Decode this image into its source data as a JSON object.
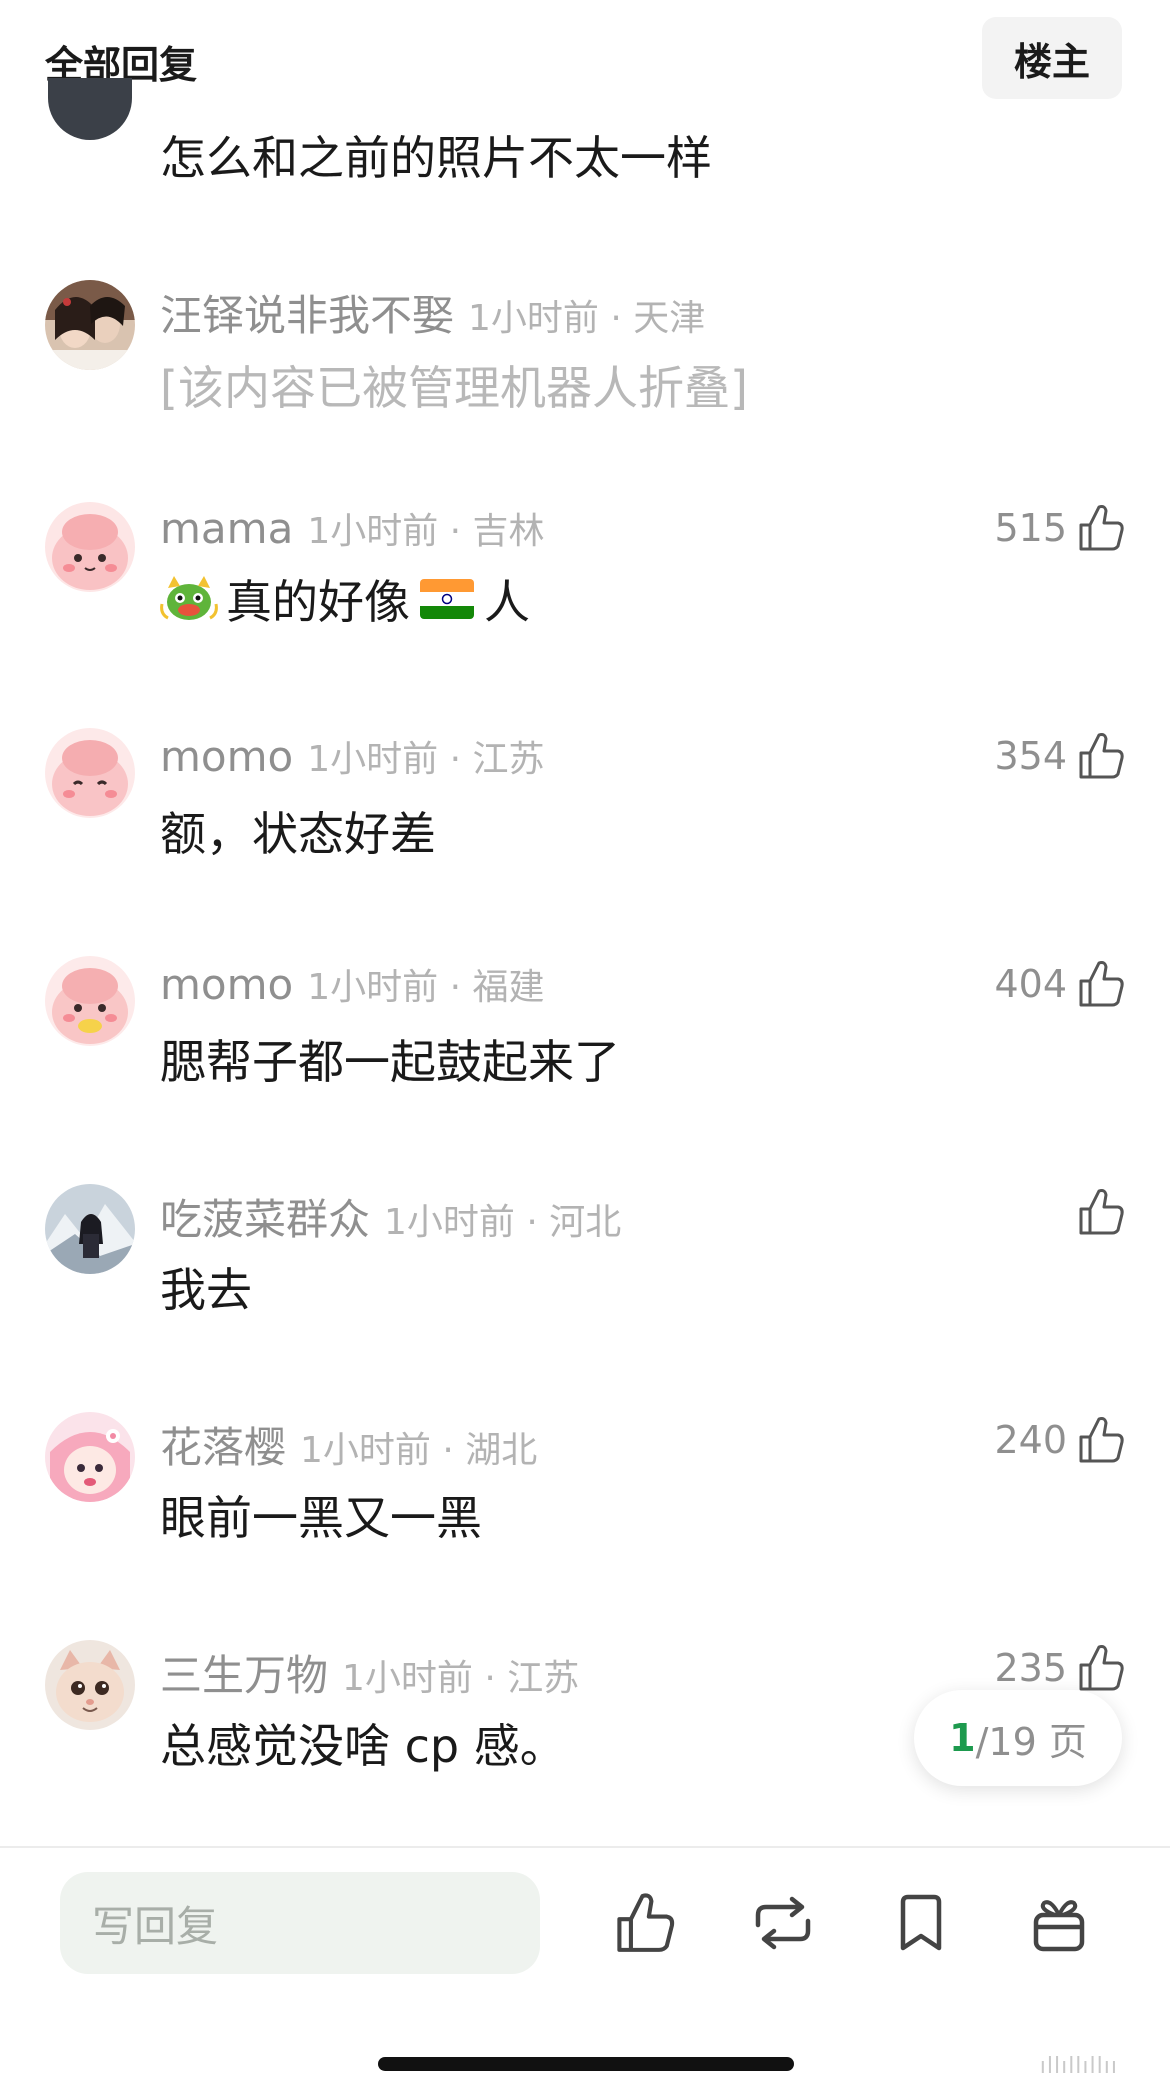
{
  "header": {
    "title": "全部回复",
    "op_button": "楼主"
  },
  "partial_comment": {
    "text": "怎么和之前的照片不太一样"
  },
  "comments": [
    {
      "username": "汪铎说非我不娶",
      "time_location": "1小时前 · 天津",
      "text": "[该内容已被管理机器人折叠]",
      "likes": ""
    },
    {
      "username": "mama",
      "time_location": "1小时前 · 吉林",
      "text_part1": "真的好像",
      "text_part2": "人",
      "likes": "515"
    },
    {
      "username": "momo",
      "time_location": "1小时前 · 江苏",
      "text": "额，状态好差",
      "likes": "354"
    },
    {
      "username": "momo",
      "time_location": "1小时前 · 福建",
      "text": "腮帮子都一起鼓起来了",
      "likes": "404"
    },
    {
      "username": "吃菠菜群众",
      "time_location": "1小时前 · 河北",
      "text": "我去",
      "likes": ""
    },
    {
      "username": "花落樱",
      "time_location": "1小时前 · 湖北",
      "text": "眼前一黑又一黑",
      "likes": "240"
    },
    {
      "username": "三生万物",
      "time_location": "1小时前 · 江苏",
      "text": "总感觉没啥 cp 感。",
      "likes": "235"
    }
  ],
  "pagination": {
    "current": "1",
    "total": "/19 页"
  },
  "bottom_bar": {
    "reply_placeholder": "写回复"
  },
  "watermark": "ıllıllıllıı"
}
